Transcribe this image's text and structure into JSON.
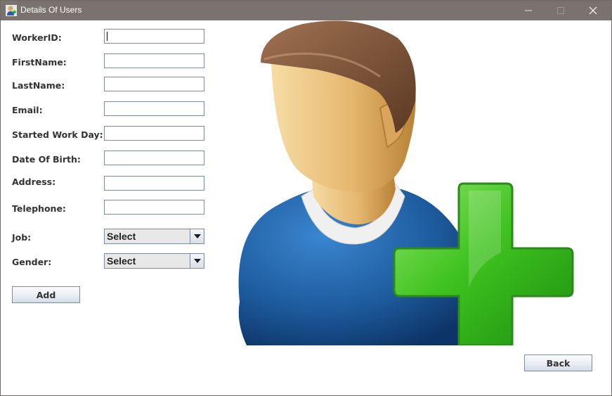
{
  "window": {
    "title": "Details Of Users",
    "controls": [
      "minimize-icon",
      "maximize-icon",
      "close-icon"
    ]
  },
  "form": {
    "fields": [
      {
        "label": "WorkerID:",
        "value": ""
      },
      {
        "label": "FirstName:",
        "value": ""
      },
      {
        "label": "LastName:",
        "value": ""
      },
      {
        "label": "Email:",
        "value": ""
      },
      {
        "label": "Started Work Day:",
        "value": ""
      },
      {
        "label": "Date Of Birth:",
        "value": ""
      },
      {
        "label": "Address:",
        "value": ""
      },
      {
        "label": "Telephone:",
        "value": ""
      }
    ],
    "job": {
      "label": "Job:",
      "selected": "Select"
    },
    "gender": {
      "label": "Gender:",
      "selected": "Select"
    },
    "add_label": "Add"
  },
  "back_label": "Back",
  "illustration": {
    "icon": "add-user-icon"
  },
  "colors": {
    "titlebar": "#7a726f",
    "shirt": "#1f5d9e",
    "plus": "#3cbf1e"
  }
}
